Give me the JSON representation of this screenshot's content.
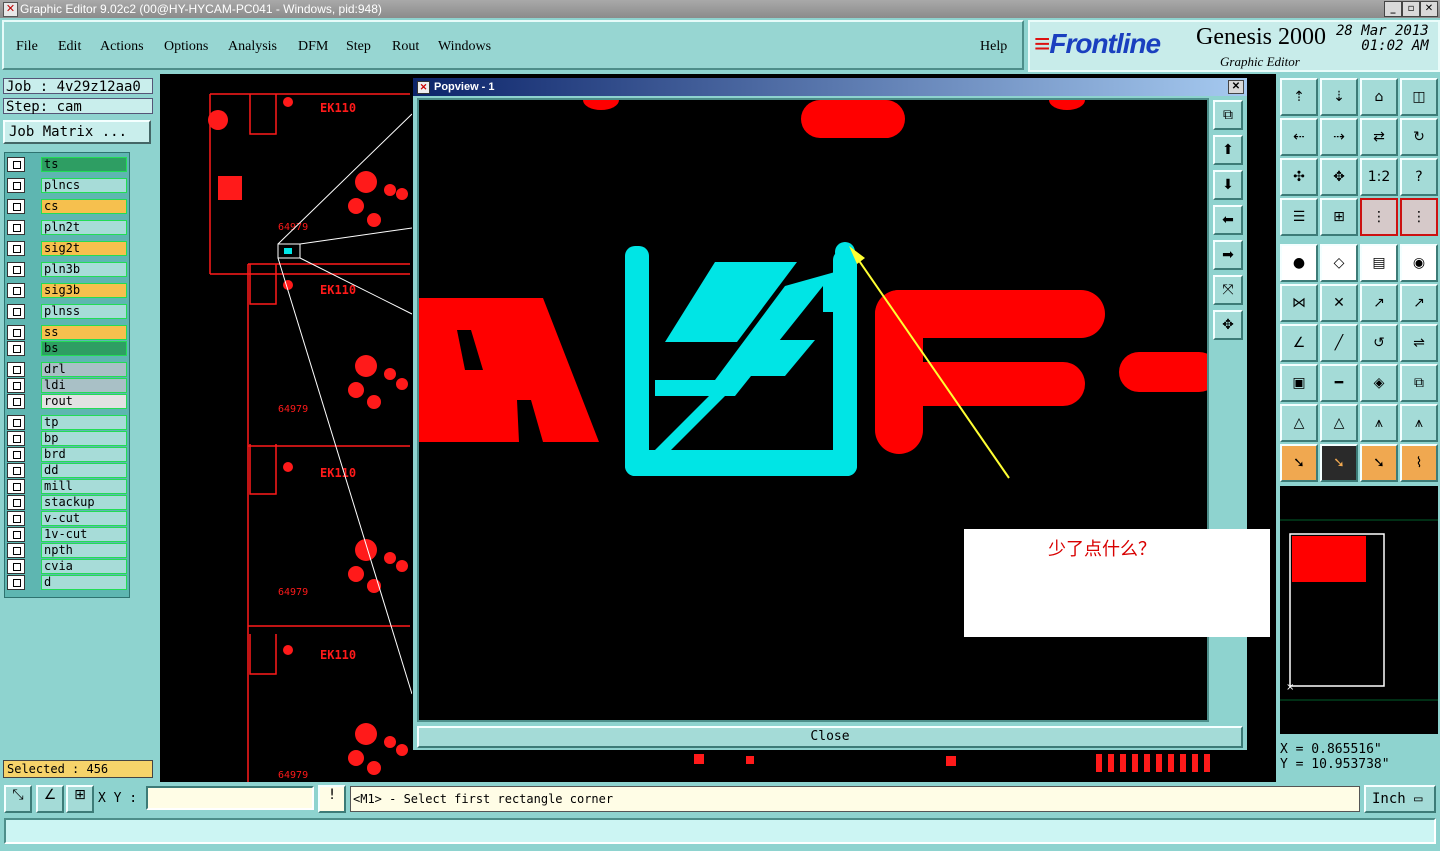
{
  "window": {
    "title": "Graphic Editor 9.02c2 (00@HY-HYCAM-PC041 - Windows, pid:948)"
  },
  "menu": [
    {
      "label": "File"
    },
    {
      "label": "Edit"
    },
    {
      "label": "Actions"
    },
    {
      "label": "Options"
    },
    {
      "label": "Analysis"
    },
    {
      "label": "DFM"
    },
    {
      "label": "Step"
    },
    {
      "label": "Rout"
    },
    {
      "label": "Windows"
    },
    {
      "label": "Help"
    }
  ],
  "brand": {
    "logo": "Frontline",
    "product": "Genesis 2000",
    "subtitle": "Graphic Editor",
    "date": "28 Mar 2013",
    "time": "01:02 AM"
  },
  "job": {
    "job": "Job : 4v29z12aa0",
    "step": "Step: cam",
    "matrix_button": "Job Matrix ..."
  },
  "layers": [
    {
      "name": "ts",
      "color": "#2e9e63"
    },
    {
      "name": "plncs",
      "color": "#a7dcd8"
    },
    {
      "name": "cs",
      "color": "#f6c04e"
    },
    {
      "name": "pln2t",
      "color": "#a7dcd8"
    },
    {
      "name": "sig2t",
      "color": "#f6c04e"
    },
    {
      "name": "pln3b",
      "color": "#a7dcd8"
    },
    {
      "name": "sig3b",
      "color": "#f6c04e"
    },
    {
      "name": "plnss",
      "color": "#a7dcd8"
    },
    {
      "name": "ss",
      "color": "#f6c04e"
    },
    {
      "name": "bs",
      "color": "#2e9e63"
    },
    {
      "name": "drl",
      "color": "#a9c0c6"
    },
    {
      "name": "ldi",
      "color": "#a9c0c6"
    },
    {
      "name": "rout",
      "color": "#e2e2e2"
    },
    {
      "name": "tp",
      "color": "#a7dcd8"
    },
    {
      "name": "bp",
      "color": "#a7dcd8"
    },
    {
      "name": "brd",
      "color": "#a7dcd8"
    },
    {
      "name": "dd",
      "color": "#a7dcd8"
    },
    {
      "name": "mill",
      "color": "#a7dcd8"
    },
    {
      "name": "stackup",
      "color": "#a7dcd8"
    },
    {
      "name": "v-cut",
      "color": "#a7dcd8"
    },
    {
      "name": "1v-cut",
      "color": "#a7dcd8"
    },
    {
      "name": "npth",
      "color": "#a7dcd8"
    },
    {
      "name": "cvia",
      "color": "#a7dcd8"
    },
    {
      "name": "d",
      "color": "#a7dcd8"
    }
  ],
  "selected": "Selected : 456",
  "board_labels": {
    "part": "64979",
    "text": "EK110"
  },
  "popview": {
    "title": "Popview - 1",
    "close": "Close"
  },
  "note": {
    "text": "少了点什么？"
  },
  "coords": {
    "x": "X =  0.865516\"",
    "y": "Y = 10.953738\""
  },
  "bottom": {
    "xy_label": "X Y :",
    "xy_value": "",
    "message": "<M1> - Select first rectangle corner",
    "unit": "Inch"
  },
  "colors": {
    "feature": "#ff0000",
    "highlight": "#00e5e5",
    "arrow": "#ffff33",
    "panel": "#8ed3cf"
  }
}
